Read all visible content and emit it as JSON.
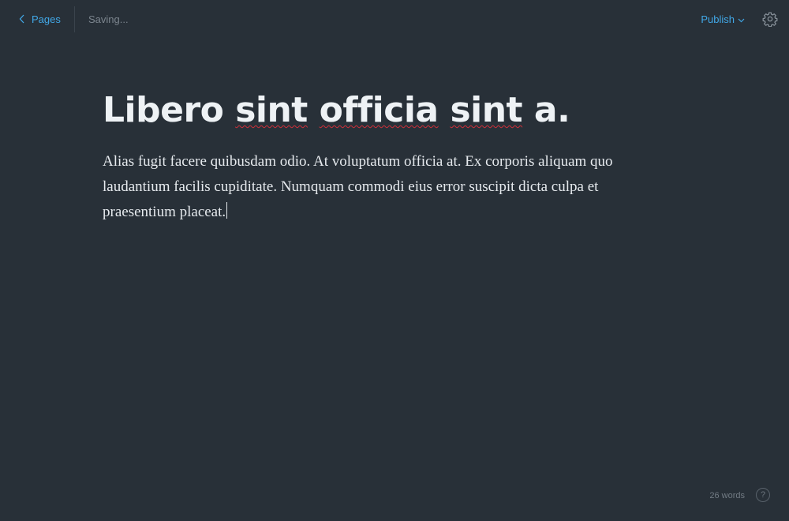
{
  "header": {
    "back_label": "Pages",
    "status": "Saving...",
    "publish_label": "Publish",
    "accent_color": "#41a7e6"
  },
  "editor": {
    "title_parts": [
      "Libero ",
      "sint",
      " ",
      "officia",
      " ",
      "sint",
      " a."
    ],
    "body": "Alias fugit facere quibusdam odio. At voluptatum officia at. Ex corporis aliquam quo laudantium facilis cupiditate. Numquam commodi eius error suscipit dicta culpa et praesentium placeat."
  },
  "footer": {
    "word_count": "26 words",
    "help_label": "?"
  },
  "icons": {
    "back": "chevron-left-icon",
    "publish_dropdown": "chevron-down-icon",
    "settings": "gear-icon",
    "help": "question-circle-icon"
  }
}
